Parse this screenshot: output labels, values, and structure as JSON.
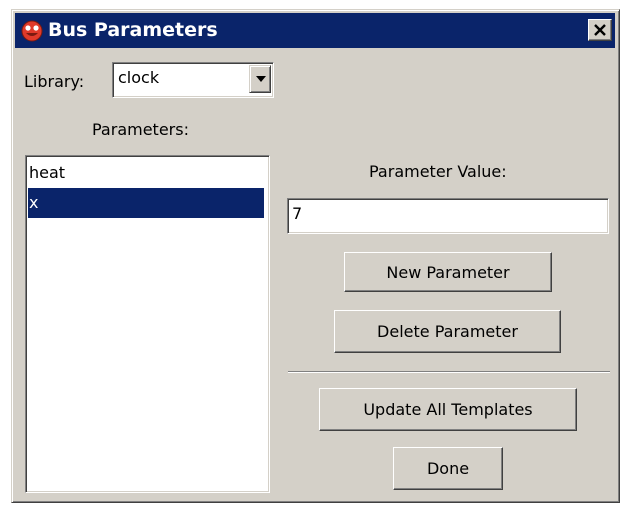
{
  "window": {
    "title": "Bus Parameters",
    "close_label": "close"
  },
  "library": {
    "label": "Library:",
    "selected": "clock"
  },
  "parameters": {
    "label": "Parameters:",
    "items": [
      "heat",
      "x"
    ],
    "selected_index": 1
  },
  "value": {
    "label": "Parameter Value:",
    "current": "7"
  },
  "buttons": {
    "new": "New Parameter",
    "delete": "Delete Parameter",
    "update": "Update All Templates",
    "done": "Done"
  },
  "colors": {
    "titlebar": "#0a246a",
    "face": "#d4d0c8",
    "selection": "#0a246a"
  },
  "icons": {
    "title": "app-icon",
    "close": "close-icon",
    "dropdown": "chevron-down-icon"
  }
}
